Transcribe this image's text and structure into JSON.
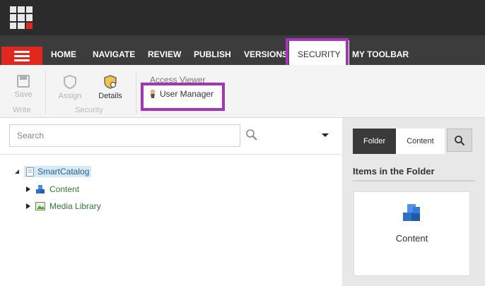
{
  "nav": {
    "tabs": [
      {
        "label": "HOME"
      },
      {
        "label": "NAVIGATE"
      },
      {
        "label": "REVIEW"
      },
      {
        "label": "PUBLISH"
      },
      {
        "label": "VERSIONS"
      },
      {
        "label": "SECURITY",
        "active": true
      },
      {
        "label": "MY TOOLBAR"
      }
    ]
  },
  "ribbon": {
    "save_label": "Save",
    "write_group": "Write",
    "assign_label": "Assign",
    "details_label": "Details",
    "security_group": "Security",
    "access_viewer_label": "Access Viewer",
    "user_manager_label": "User Manager"
  },
  "search": {
    "placeholder": "Search"
  },
  "tree": {
    "root": "SmartCatalog",
    "children": [
      "Content",
      "Media Library"
    ]
  },
  "right": {
    "tabs": [
      "Folder",
      "Content"
    ],
    "heading": "Items in the Folder",
    "item_label": "Content"
  },
  "colors": {
    "accent_red": "#e0281e",
    "highlight_purple": "#a434b8",
    "nav_bg": "#3c3c3c",
    "top_bg": "#2b2b2b"
  }
}
